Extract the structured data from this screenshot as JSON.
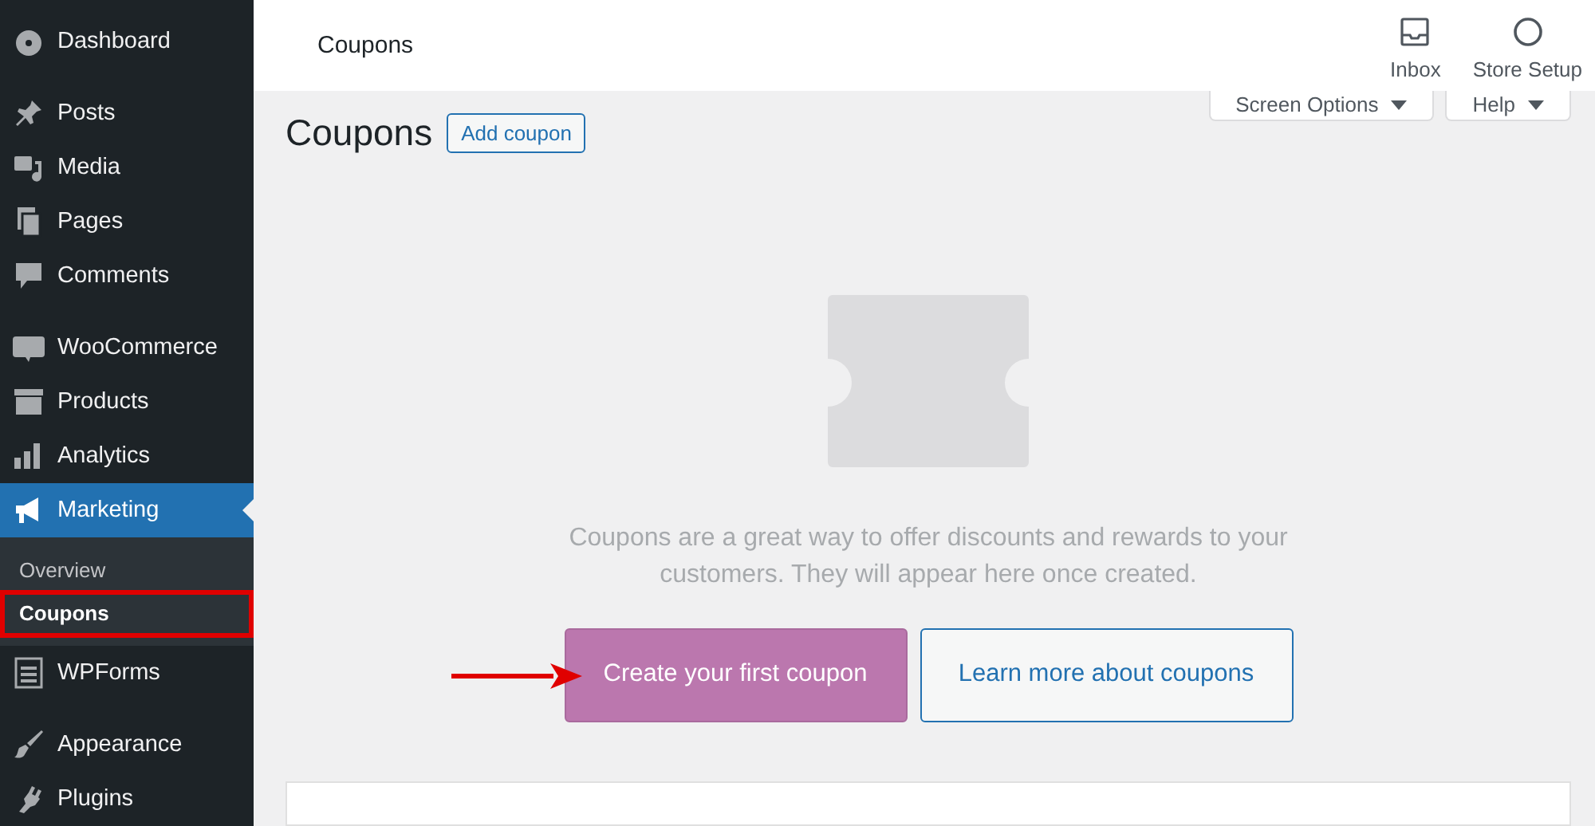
{
  "sidebar": {
    "groups": [
      {
        "items": [
          {
            "label": "Dashboard",
            "selected": false
          }
        ]
      },
      {
        "items": [
          {
            "label": "Posts",
            "selected": false
          },
          {
            "label": "Media",
            "selected": false
          },
          {
            "label": "Pages",
            "selected": false
          },
          {
            "label": "Comments",
            "selected": false
          }
        ]
      },
      {
        "items": [
          {
            "label": "WooCommerce",
            "selected": false
          },
          {
            "label": "Products",
            "selected": false
          },
          {
            "label": "Analytics",
            "selected": false
          },
          {
            "label": "Marketing",
            "selected": true,
            "submenu": [
              {
                "label": "Overview",
                "selected": false,
                "highlighted": false
              },
              {
                "label": "Coupons",
                "selected": true,
                "highlighted": true
              }
            ]
          },
          {
            "label": "WPForms",
            "selected": false
          }
        ]
      },
      {
        "items": [
          {
            "label": "Appearance",
            "selected": false
          },
          {
            "label": "Plugins",
            "selected": false
          }
        ]
      }
    ]
  },
  "header": {
    "title": "Coupons",
    "actions": [
      {
        "label": "Inbox"
      },
      {
        "label": "Store Setup"
      }
    ]
  },
  "screen_tabs": [
    {
      "label": "Screen Options"
    },
    {
      "label": "Help"
    }
  ],
  "page": {
    "title": "Coupons",
    "add_button": "Add coupon"
  },
  "empty_state": {
    "message": "Coupons are a great way to offer discounts and rewards to your customers. They will appear here once created.",
    "primary_button": {
      "label": "Create your first coupon",
      "pointed": true
    },
    "secondary_button": {
      "label": "Learn more about coupons"
    }
  }
}
